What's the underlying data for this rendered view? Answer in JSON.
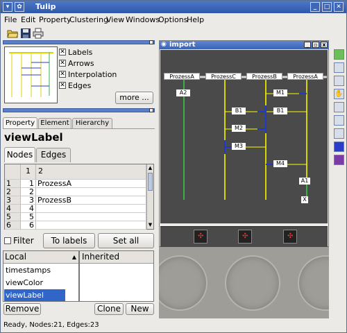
{
  "app": {
    "title": "Tulip"
  },
  "menu": [
    "File",
    "Edit",
    "Property",
    "Clustering",
    "View",
    "Windows",
    "Options",
    "Help"
  ],
  "toolbar": {
    "icons": [
      "open-folder-icon",
      "save-icon",
      "print-icon"
    ]
  },
  "overview": {
    "options": [
      {
        "label": "Labels",
        "checked": true
      },
      {
        "label": "Arrows",
        "checked": true
      },
      {
        "label": "Interpolation",
        "checked": true
      },
      {
        "label": "Edges",
        "checked": true
      }
    ],
    "more_label": "more ..."
  },
  "property_panel": {
    "tabs": [
      "Property",
      "Element",
      "Hierarchy"
    ],
    "active_tab": "Property",
    "title": "viewLabel",
    "subtabs": [
      "Nodes",
      "Edges"
    ],
    "active_subtab": "Nodes",
    "table": {
      "columns": [
        "1",
        "2"
      ],
      "rows": [
        {
          "row": "1",
          "id": "1",
          "value": "ProzessA"
        },
        {
          "row": "2",
          "id": "2",
          "value": ""
        },
        {
          "row": "3",
          "id": "3",
          "value": "ProzessB"
        },
        {
          "row": "4",
          "id": "4",
          "value": ""
        },
        {
          "row": "5",
          "id": "5",
          "value": ""
        },
        {
          "row": "6",
          "id": "6",
          "value": ""
        }
      ]
    },
    "filter_label": "Filter",
    "to_labels_label": "To labels",
    "set_all_label": "Set all",
    "local_header": "Local",
    "inherited_header": "Inherited",
    "local_items": [
      "timestamps",
      "viewColor",
      "viewLabel"
    ],
    "selected_local": "viewLabel",
    "remove_label": "Remove",
    "clone_label": "Clone",
    "new_label": "New"
  },
  "graph_window": {
    "title": "import",
    "process_labels": [
      "ProzessA",
      "ProzessC",
      "ProzessB",
      "ProzessA"
    ],
    "node_labels": [
      "A2",
      "M1",
      "B1",
      "B1",
      "M2",
      "M3",
      "M4",
      "A1",
      "X"
    ]
  },
  "status": {
    "text": "Ready, Nodes:21, Edges:23"
  },
  "colors": {
    "accent": "#3961b6",
    "selection": "#3166c8",
    "canvas": "#4a4a4a"
  }
}
